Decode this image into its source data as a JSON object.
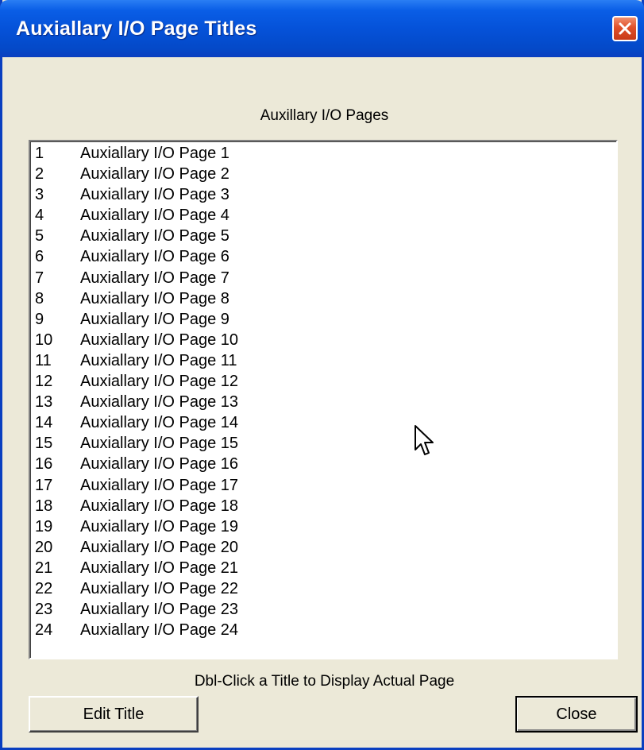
{
  "window": {
    "title": "Auxiallary I/O Page Titles"
  },
  "list_header": "Auxillary I/O Pages",
  "pages": [
    {
      "num": "1",
      "title": "Auxiallary I/O Page 1"
    },
    {
      "num": "2",
      "title": "Auxiallary I/O Page 2"
    },
    {
      "num": "3",
      "title": "Auxiallary I/O Page 3"
    },
    {
      "num": "4",
      "title": "Auxiallary I/O Page 4"
    },
    {
      "num": "5",
      "title": "Auxiallary I/O Page 5"
    },
    {
      "num": "6",
      "title": "Auxiallary I/O Page 6"
    },
    {
      "num": "7",
      "title": "Auxiallary I/O Page 7"
    },
    {
      "num": "8",
      "title": "Auxiallary I/O Page 8"
    },
    {
      "num": "9",
      "title": "Auxiallary I/O Page 9"
    },
    {
      "num": "10",
      "title": "Auxiallary I/O Page 10"
    },
    {
      "num": "11",
      "title": "Auxiallary I/O Page 11"
    },
    {
      "num": "12",
      "title": "Auxiallary I/O Page 12"
    },
    {
      "num": "13",
      "title": "Auxiallary I/O Page 13"
    },
    {
      "num": "14",
      "title": "Auxiallary I/O Page 14"
    },
    {
      "num": "15",
      "title": "Auxiallary I/O Page 15"
    },
    {
      "num": "16",
      "title": "Auxiallary I/O Page 16"
    },
    {
      "num": "17",
      "title": "Auxiallary I/O Page 17"
    },
    {
      "num": "18",
      "title": "Auxiallary I/O Page 18"
    },
    {
      "num": "19",
      "title": "Auxiallary I/O Page 19"
    },
    {
      "num": "20",
      "title": "Auxiallary I/O Page 20"
    },
    {
      "num": "21",
      "title": "Auxiallary I/O Page 21"
    },
    {
      "num": "22",
      "title": "Auxiallary I/O Page 22"
    },
    {
      "num": "23",
      "title": "Auxiallary I/O Page 23"
    },
    {
      "num": "24",
      "title": "Auxiallary I/O Page 24"
    }
  ],
  "hint": "Dbl-Click a Title to Display Actual Page",
  "buttons": {
    "edit_title": "Edit Title",
    "close": "Close"
  },
  "icons": {
    "close_icon": "close-icon",
    "cursor_icon": "mouse-pointer-icon"
  },
  "colors": {
    "titlebar": "#0552d9",
    "close_button": "#e0502a",
    "window_bg": "#ece9d8"
  }
}
